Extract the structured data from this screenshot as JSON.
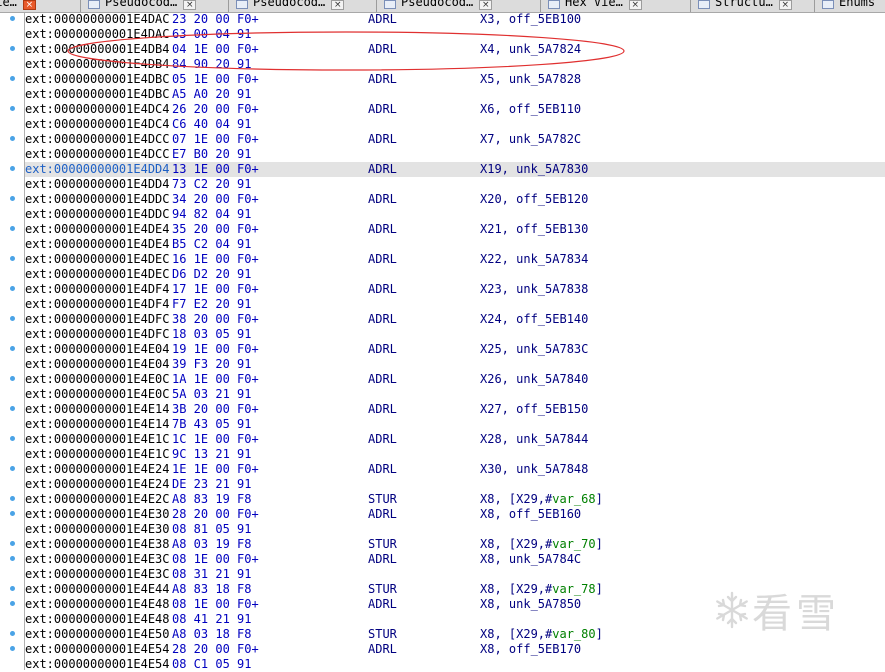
{
  "tabs": [
    {
      "label": "Vie…",
      "close": "×",
      "active": true
    },
    {
      "label": "Pseudocod…",
      "close": "×",
      "active": false
    },
    {
      "label": "Pseudocod…",
      "close": "×",
      "active": false
    },
    {
      "label": "Pseudocod…",
      "close": "×",
      "active": false
    },
    {
      "label": "Hex Vie…",
      "close": "×",
      "active": false
    },
    {
      "label": "Structu…",
      "close": "×",
      "active": false
    },
    {
      "label": "Enums",
      "close": "",
      "active": false
    }
  ],
  "listing": {
    "highlighted_index": 10,
    "rows": [
      {
        "addr": "ext:00000000001E4DAC",
        "bytes": "23 20 00 F0+",
        "mnemonic": "ADRL",
        "operand": "X3, off_5EB100"
      },
      {
        "addr": "ext:00000000001E4DAC",
        "bytes": "63 00 04 91",
        "mnemonic": "",
        "operand": ""
      },
      {
        "addr": "ext:00000000001E4DB4",
        "bytes": "04 1E 00 F0+",
        "mnemonic": "ADRL",
        "operand": "X4, unk_5A7824"
      },
      {
        "addr": "ext:00000000001E4DB4",
        "bytes": "84 90 20 91",
        "mnemonic": "",
        "operand": ""
      },
      {
        "addr": "ext:00000000001E4DBC",
        "bytes": "05 1E 00 F0+",
        "mnemonic": "ADRL",
        "operand": "X5, unk_5A7828"
      },
      {
        "addr": "ext:00000000001E4DBC",
        "bytes": "A5 A0 20 91",
        "mnemonic": "",
        "operand": ""
      },
      {
        "addr": "ext:00000000001E4DC4",
        "bytes": "26 20 00 F0+",
        "mnemonic": "ADRL",
        "operand": "X6, off_5EB110"
      },
      {
        "addr": "ext:00000000001E4DC4",
        "bytes": "C6 40 04 91",
        "mnemonic": "",
        "operand": ""
      },
      {
        "addr": "ext:00000000001E4DCC",
        "bytes": "07 1E 00 F0+",
        "mnemonic": "ADRL",
        "operand": "X7, unk_5A782C"
      },
      {
        "addr": "ext:00000000001E4DCC",
        "bytes": "E7 B0 20 91",
        "mnemonic": "",
        "operand": ""
      },
      {
        "addr": "ext:00000000001E4DD4",
        "bytes": "13 1E 00 F0+",
        "mnemonic": "ADRL",
        "operand": "X19, unk_5A7830"
      },
      {
        "addr": "ext:00000000001E4DD4",
        "bytes": "73 C2 20 91",
        "mnemonic": "",
        "operand": ""
      },
      {
        "addr": "ext:00000000001E4DDC",
        "bytes": "34 20 00 F0+",
        "mnemonic": "ADRL",
        "operand": "X20, off_5EB120"
      },
      {
        "addr": "ext:00000000001E4DDC",
        "bytes": "94 82 04 91",
        "mnemonic": "",
        "operand": ""
      },
      {
        "addr": "ext:00000000001E4DE4",
        "bytes": "35 20 00 F0+",
        "mnemonic": "ADRL",
        "operand": "X21, off_5EB130"
      },
      {
        "addr": "ext:00000000001E4DE4",
        "bytes": "B5 C2 04 91",
        "mnemonic": "",
        "operand": ""
      },
      {
        "addr": "ext:00000000001E4DEC",
        "bytes": "16 1E 00 F0+",
        "mnemonic": "ADRL",
        "operand": "X22, unk_5A7834"
      },
      {
        "addr": "ext:00000000001E4DEC",
        "bytes": "D6 D2 20 91",
        "mnemonic": "",
        "operand": ""
      },
      {
        "addr": "ext:00000000001E4DF4",
        "bytes": "17 1E 00 F0+",
        "mnemonic": "ADRL",
        "operand": "X23, unk_5A7838"
      },
      {
        "addr": "ext:00000000001E4DF4",
        "bytes": "F7 E2 20 91",
        "mnemonic": "",
        "operand": ""
      },
      {
        "addr": "ext:00000000001E4DFC",
        "bytes": "38 20 00 F0+",
        "mnemonic": "ADRL",
        "operand": "X24, off_5EB140"
      },
      {
        "addr": "ext:00000000001E4DFC",
        "bytes": "18 03 05 91",
        "mnemonic": "",
        "operand": ""
      },
      {
        "addr": "ext:00000000001E4E04",
        "bytes": "19 1E 00 F0+",
        "mnemonic": "ADRL",
        "operand": "X25, unk_5A783C"
      },
      {
        "addr": "ext:00000000001E4E04",
        "bytes": "39 F3 20 91",
        "mnemonic": "",
        "operand": ""
      },
      {
        "addr": "ext:00000000001E4E0C",
        "bytes": "1A 1E 00 F0+",
        "mnemonic": "ADRL",
        "operand": "X26, unk_5A7840"
      },
      {
        "addr": "ext:00000000001E4E0C",
        "bytes": "5A 03 21 91",
        "mnemonic": "",
        "operand": ""
      },
      {
        "addr": "ext:00000000001E4E14",
        "bytes": "3B 20 00 F0+",
        "mnemonic": "ADRL",
        "operand": "X27, off_5EB150"
      },
      {
        "addr": "ext:00000000001E4E14",
        "bytes": "7B 43 05 91",
        "mnemonic": "",
        "operand": ""
      },
      {
        "addr": "ext:00000000001E4E1C",
        "bytes": "1C 1E 00 F0+",
        "mnemonic": "ADRL",
        "operand": "X28, unk_5A7844"
      },
      {
        "addr": "ext:00000000001E4E1C",
        "bytes": "9C 13 21 91",
        "mnemonic": "",
        "operand": ""
      },
      {
        "addr": "ext:00000000001E4E24",
        "bytes": "1E 1E 00 F0+",
        "mnemonic": "ADRL",
        "operand": "X30, unk_5A7848"
      },
      {
        "addr": "ext:00000000001E4E24",
        "bytes": "DE 23 21 91",
        "mnemonic": "",
        "operand": ""
      },
      {
        "addr": "ext:00000000001E4E2C",
        "bytes": "A8 83 19 F8",
        "mnemonic": "STUR",
        "operand": "X8, [X29,#",
        "var": "var_68",
        "tail": "]"
      },
      {
        "addr": "ext:00000000001E4E30",
        "bytes": "28 20 00 F0+",
        "mnemonic": "ADRL",
        "operand": "X8, off_5EB160"
      },
      {
        "addr": "ext:00000000001E4E30",
        "bytes": "08 81 05 91",
        "mnemonic": "",
        "operand": ""
      },
      {
        "addr": "ext:00000000001E4E38",
        "bytes": "A8 03 19 F8",
        "mnemonic": "STUR",
        "operand": "X8, [X29,#",
        "var": "var_70",
        "tail": "]"
      },
      {
        "addr": "ext:00000000001E4E3C",
        "bytes": "08 1E 00 F0+",
        "mnemonic": "ADRL",
        "operand": "X8, unk_5A784C"
      },
      {
        "addr": "ext:00000000001E4E3C",
        "bytes": "08 31 21 91",
        "mnemonic": "",
        "operand": ""
      },
      {
        "addr": "ext:00000000001E4E44",
        "bytes": "A8 83 18 F8",
        "mnemonic": "STUR",
        "operand": "X8, [X29,#",
        "var": "var_78",
        "tail": "]"
      },
      {
        "addr": "ext:00000000001E4E48",
        "bytes": "08 1E 00 F0+",
        "mnemonic": "ADRL",
        "operand": "X8, unk_5A7850"
      },
      {
        "addr": "ext:00000000001E4E48",
        "bytes": "08 41 21 91",
        "mnemonic": "",
        "operand": ""
      },
      {
        "addr": "ext:00000000001E4E50",
        "bytes": "A8 03 18 F8",
        "mnemonic": "STUR",
        "operand": "X8, [X29,#",
        "var": "var_80",
        "tail": "]"
      },
      {
        "addr": "ext:00000000001E4E54",
        "bytes": "28 20 00 F0+",
        "mnemonic": "ADRL",
        "operand": "X8, off_5EB170"
      },
      {
        "addr": "ext:00000000001E4E54",
        "bytes": "08 C1 05 91",
        "mnemonic": "",
        "operand": ""
      }
    ]
  },
  "gutter_dot_rows": [
    0,
    2,
    4,
    6,
    8,
    10,
    12,
    14,
    16,
    18,
    20,
    22,
    24,
    26,
    28,
    30,
    32,
    33,
    35,
    36,
    38,
    39,
    41,
    42
  ],
  "watermark": {
    "text": "看雪",
    "icon": "snowflake-logo-icon"
  },
  "colors": {
    "address": "#000000",
    "bytes": "#0000c0",
    "code": "#000080",
    "stack_var": "#008000",
    "highlight": "#e3e3e3",
    "annotation": "#e03030",
    "gutter_dot": "#4aa3e6"
  }
}
